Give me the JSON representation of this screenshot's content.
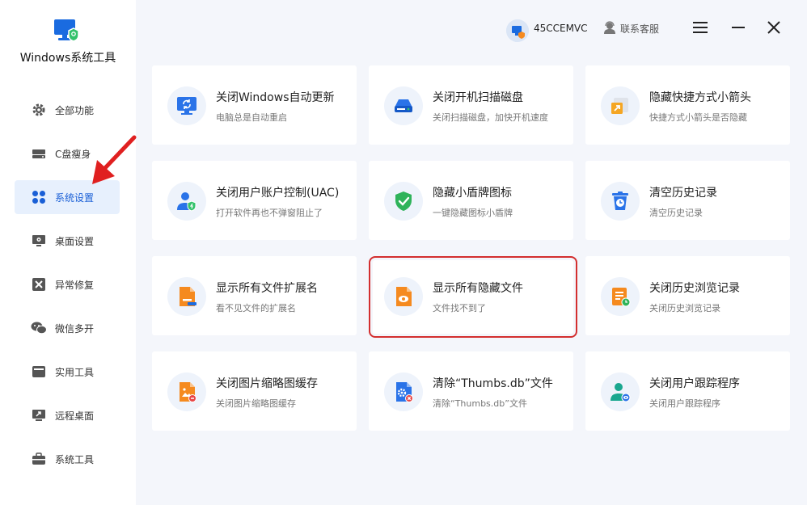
{
  "app": {
    "title": "Windows系统工具"
  },
  "sidebar": {
    "items": [
      {
        "label": "全部功能",
        "icon": "gear-icon"
      },
      {
        "label": "C盘瘦身",
        "icon": "drive-icon"
      },
      {
        "label": "系统设置",
        "icon": "grid-icon",
        "active": true
      },
      {
        "label": "桌面设置",
        "icon": "monitor-settings-icon"
      },
      {
        "label": "异常修复",
        "icon": "wrench-icon"
      },
      {
        "label": "微信多开",
        "icon": "wechat-icon"
      },
      {
        "label": "实用工具",
        "icon": "toolbox-icon"
      },
      {
        "label": "远程桌面",
        "icon": "remote-desktop-icon"
      },
      {
        "label": "系统工具",
        "icon": "briefcase-icon"
      }
    ]
  },
  "header": {
    "username": "45CCEMVC",
    "service_label": "联系客服"
  },
  "cards": [
    {
      "title": "关闭Windows自动更新",
      "subtitle": "电脑总是自动重启",
      "icon": "monitor-refresh-icon"
    },
    {
      "title": "关闭开机扫描磁盘",
      "subtitle": "关闭扫描磁盘，加快开机速度",
      "icon": "disk-scan-icon"
    },
    {
      "title": "隐藏快捷方式小箭头",
      "subtitle": "快捷方式小箭头是否隐藏",
      "icon": "shortcut-arrow-icon"
    },
    {
      "title": "关闭用户账户控制(UAC)",
      "subtitle": "打开软件再也不弹窗阻止了",
      "icon": "user-shield-icon"
    },
    {
      "title": "隐藏小盾牌图标",
      "subtitle": "一键隐藏图标小盾牌",
      "icon": "shield-check-icon"
    },
    {
      "title": "清空历史记录",
      "subtitle": "清空历史记录",
      "icon": "trash-clock-icon"
    },
    {
      "title": "显示所有文件扩展名",
      "subtitle": "看不见文件的扩展名",
      "icon": "file-extension-icon"
    },
    {
      "title": "显示所有隐藏文件",
      "subtitle": "文件找不到了",
      "icon": "file-eye-icon",
      "highlighted": true
    },
    {
      "title": "关闭历史浏览记录",
      "subtitle": "关闭历史浏览记录",
      "icon": "document-clock-icon"
    },
    {
      "title": "关闭图片缩略图缓存",
      "subtitle": "关闭图片缩略图缓存",
      "icon": "image-file-icon"
    },
    {
      "title": "清除“Thumbs.db”文件",
      "subtitle": "清除“Thumbs.db”文件",
      "icon": "file-gear-icon"
    },
    {
      "title": "关闭用户跟踪程序",
      "subtitle": "关闭用户跟踪程序",
      "icon": "user-eye-icon"
    }
  ],
  "colors": {
    "accent": "#1a5fd6",
    "highlight": "#d32f2f",
    "orange": "#f58a1f",
    "green": "#2fb35a"
  }
}
